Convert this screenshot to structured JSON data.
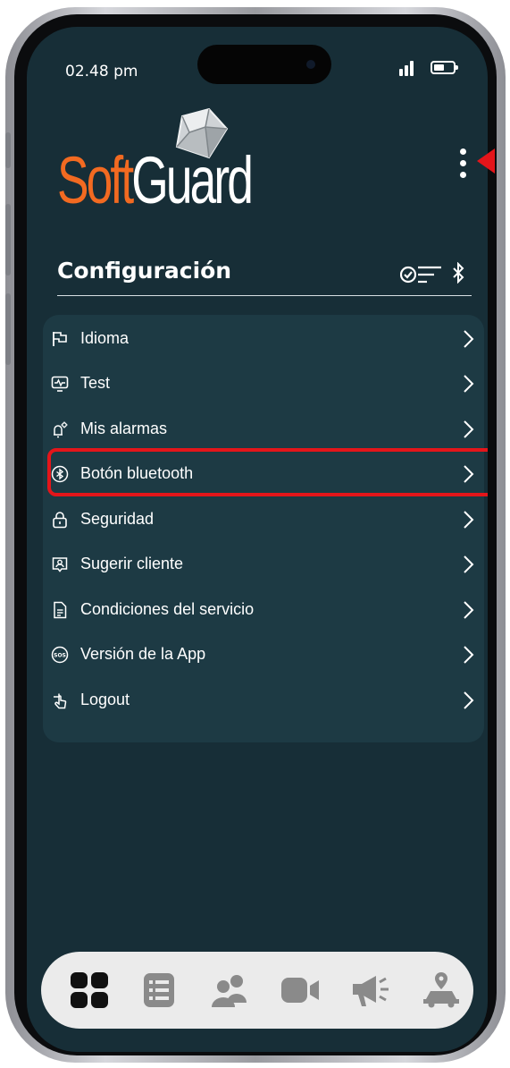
{
  "status_bar": {
    "time": "02.48 pm"
  },
  "logo": {
    "soft": "Soft",
    "guard": "Guard",
    "colors": {
      "soft": "#f26a21",
      "guard": "#ffffff"
    }
  },
  "header": {
    "title": "Configuración",
    "icons": [
      "filter-check-icon",
      "bluetooth-icon"
    ]
  },
  "menu": {
    "items": [
      {
        "label": "Idioma",
        "icon": "flag-icon"
      },
      {
        "label": "Test",
        "icon": "monitor-pulse-icon"
      },
      {
        "label": "Mis alarmas",
        "icon": "bell-settings-icon"
      },
      {
        "label": "Botón bluetooth",
        "icon": "bluetooth-circle-icon",
        "highlighted": true
      },
      {
        "label": "Seguridad",
        "icon": "lock-icon"
      },
      {
        "label": "Sugerir cliente",
        "icon": "user-badge-icon"
      },
      {
        "label": "Condiciones del servicio",
        "icon": "document-icon"
      },
      {
        "label": "Versión de la App",
        "icon": "sos-icon"
      },
      {
        "label": "Logout",
        "icon": "hand-logout-icon"
      }
    ]
  },
  "tab_bar": {
    "tabs": [
      {
        "name": "dashboard",
        "icon": "grid-icon",
        "active": true
      },
      {
        "name": "list",
        "icon": "list-icon",
        "active": false
      },
      {
        "name": "contacts",
        "icon": "people-icon",
        "active": false
      },
      {
        "name": "video",
        "icon": "video-camera-icon",
        "active": false
      },
      {
        "name": "announcements",
        "icon": "megaphone-icon",
        "active": false
      },
      {
        "name": "tracking",
        "icon": "car-location-icon",
        "active": false
      }
    ]
  },
  "colors": {
    "background": "#172e37",
    "card": "#1d3a44",
    "accent_orange": "#f26a21",
    "highlight_red": "#e4151a",
    "tab_active": "#111111",
    "tab_inactive": "#8a8a8a"
  }
}
